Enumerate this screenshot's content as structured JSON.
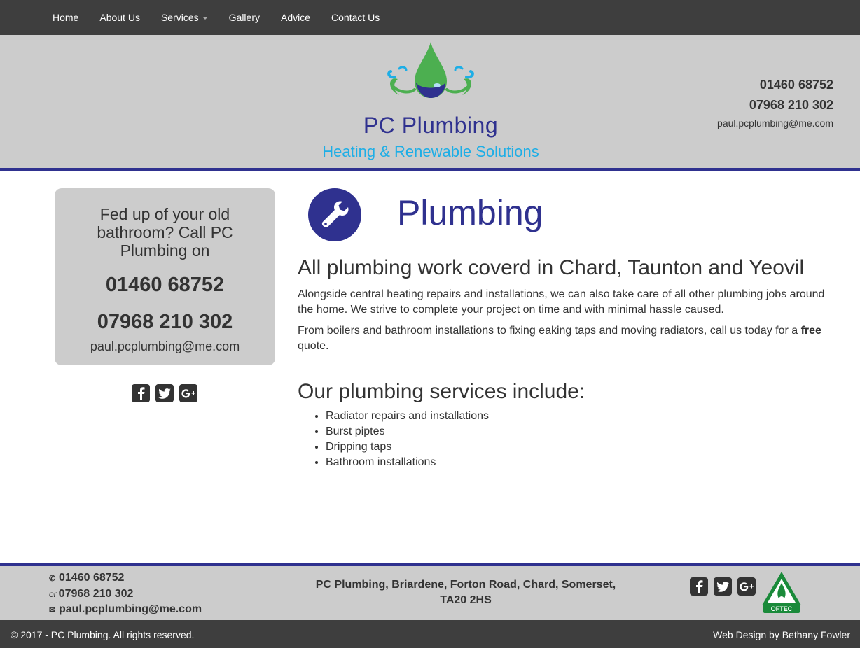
{
  "nav": {
    "items": [
      {
        "label": "Home"
      },
      {
        "label": "About Us"
      },
      {
        "label": "Services"
      },
      {
        "label": "Gallery"
      },
      {
        "label": "Advice"
      },
      {
        "label": "Contact Us"
      }
    ]
  },
  "header": {
    "logo_title": "PC Plumbing",
    "logo_subtitle": "Heating & Renewable Solutions",
    "phone1": "01460 68752",
    "phone2": "07968 210 302",
    "email": "paul.pcplumbing@me.com"
  },
  "sidebar": {
    "lead": "Fed up of your old bathroom? Call PC Plumbing on",
    "phone1": "01460 68752",
    "phone2": "07968 210 302",
    "email": "paul.pcplumbing@me.com",
    "social": [
      "facebook-icon",
      "twitter-icon",
      "google-plus-icon"
    ]
  },
  "main": {
    "title": "Plumbing",
    "heading": "All plumbing work coverd in Chard, Taunton and Yeovil",
    "para1": "Alongside central heating repairs and installations, we can also take care of all other plumbing jobs around the home. We strive to complete your project on time and with minimal hassle caused.",
    "para2_before": "From boilers and bathroom installations to fixing eaking taps and moving radiators, call us today for a ",
    "para2_bold": "free",
    "para2_after": " quote.",
    "services_heading": "Our plumbing services include:",
    "services": [
      "Radiator repairs and installations",
      "Burst piptes",
      "Dripping taps",
      "Bathroom installations"
    ]
  },
  "footer": {
    "phone1": "01460 68752",
    "or_label": "or",
    "phone2": "07968 210 302",
    "email": "paul.pcplumbing@me.com",
    "address_line1": "PC Plumbing, Briardene, Forton Road, Chard, Somerset,",
    "address_line2": "TA20 2HS",
    "badge": "OFTEC",
    "copyright": "© 2017 - PC Plumbing. All rights reserved.",
    "credit": "Web Design by Bethany Fowler"
  },
  "colors": {
    "brand_blue": "#2f318f",
    "accent_cyan": "#1eaee6",
    "drop_green": "#4caf50",
    "nav_bg": "#3e3e3e",
    "panel_grey": "#cccccc",
    "oftec_green": "#1a8a3a"
  }
}
